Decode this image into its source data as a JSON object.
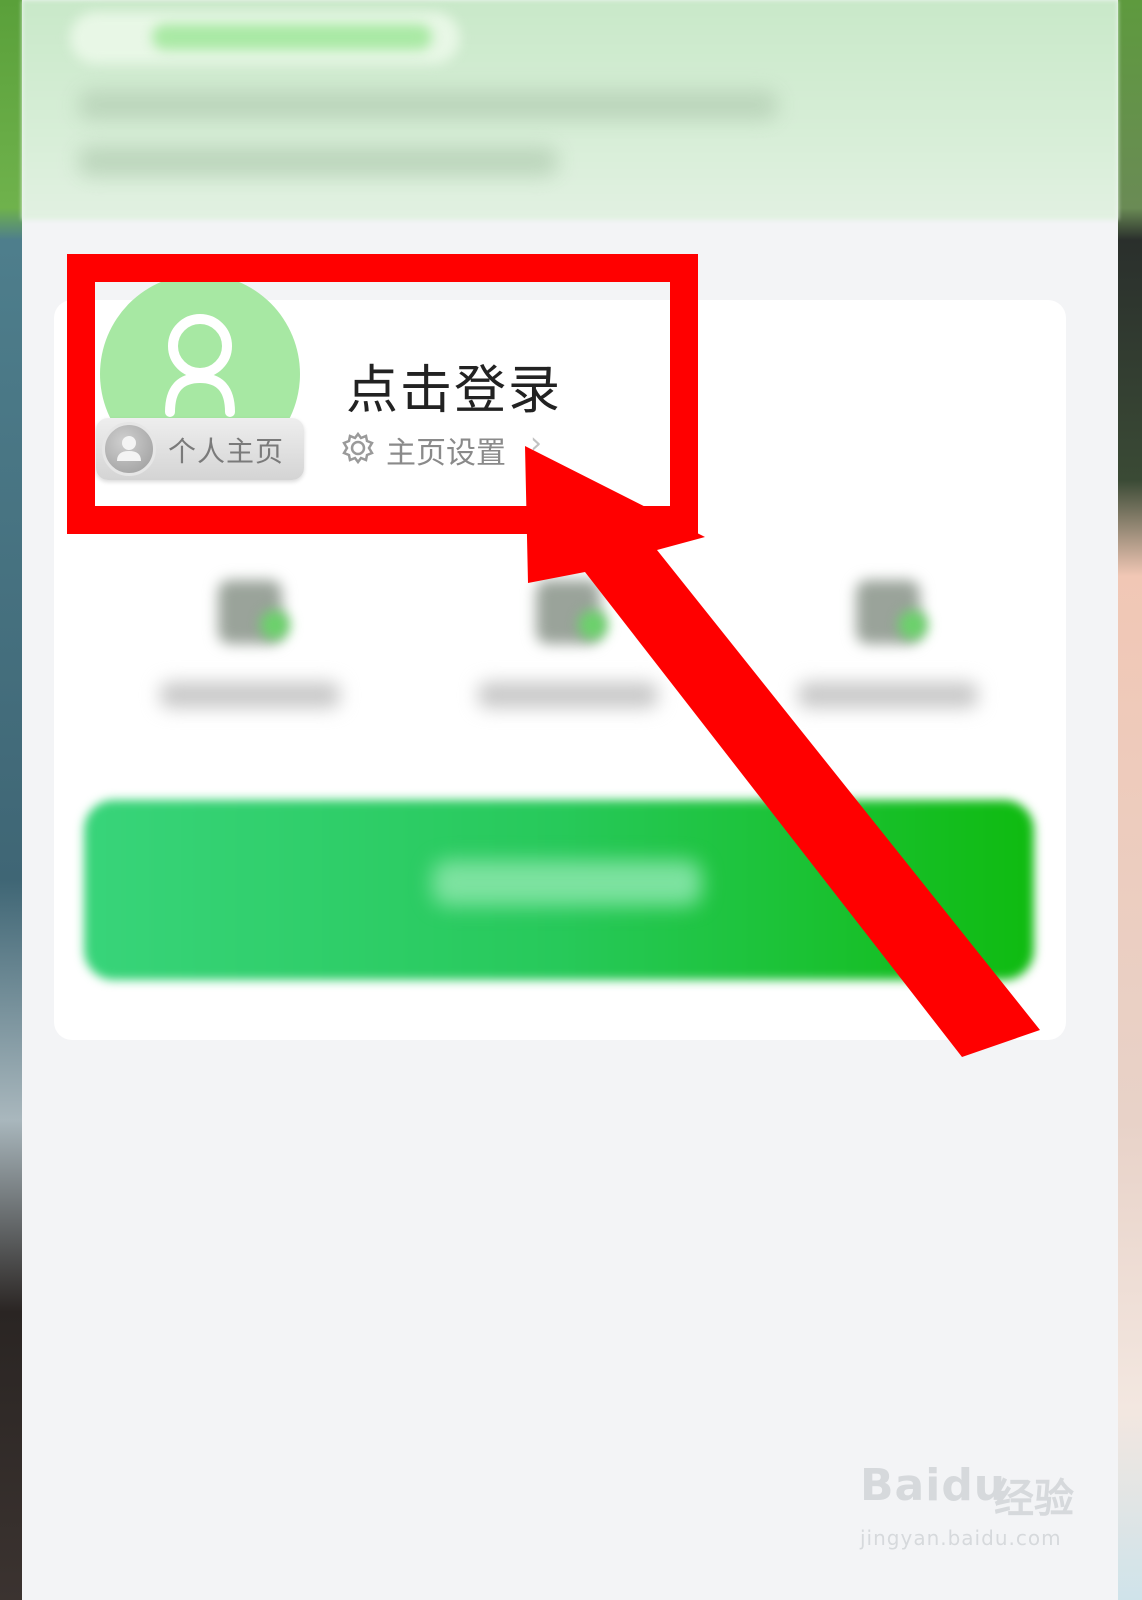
{
  "profile": {
    "login_title": "点击登录",
    "home_badge": "个人主页",
    "settings_label": "主页设置",
    "settings_chevron": "›"
  },
  "icons": {
    "avatar": "user-silhouette-icon",
    "badge": "person-icon",
    "settings": "gear-icon",
    "chevron": "chevron-right-icon"
  },
  "watermark": {
    "logo": "Bai",
    "logo_tail": "du",
    "brand": "经验",
    "url": "jingyan.baidu.com"
  },
  "colors": {
    "avatar_bg": "#a7e8a3",
    "annotation": "#ff0000",
    "primary_green": "#27c95a"
  }
}
